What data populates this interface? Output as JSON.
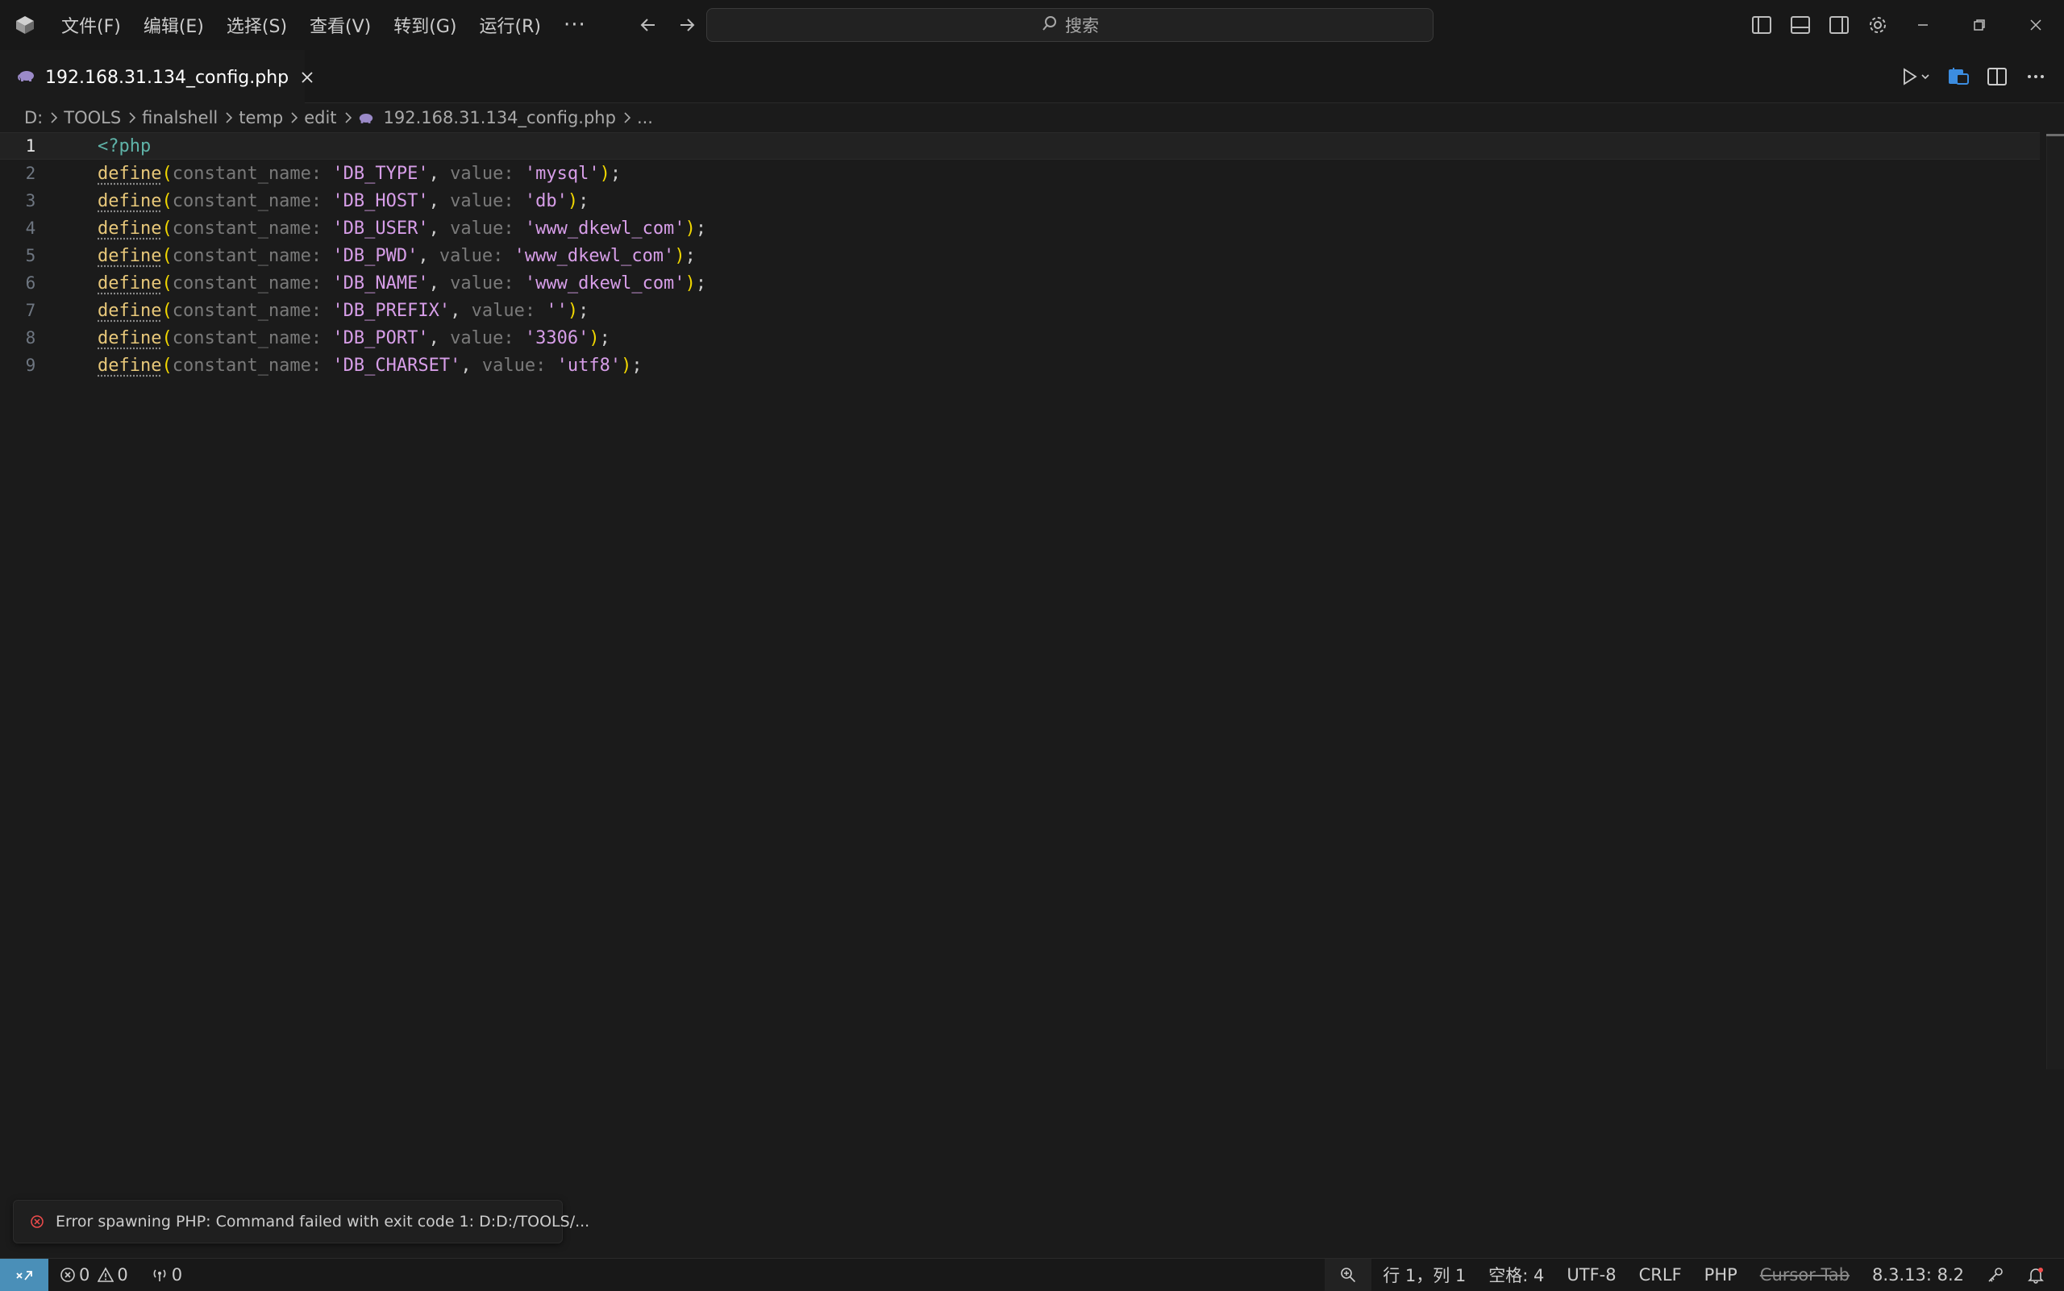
{
  "menu": {
    "items": [
      "文件(F)",
      "编辑(E)",
      "选择(S)",
      "查看(V)",
      "转到(G)",
      "运行(R)"
    ],
    "more": "···"
  },
  "search": {
    "label": "搜索"
  },
  "tab": {
    "label": "192.168.31.134_config.php"
  },
  "breadcrumb": {
    "items": [
      "D:",
      "TOOLS",
      "finalshell",
      "temp",
      "edit"
    ],
    "file": "192.168.31.134_config.php",
    "tail": "..."
  },
  "editor": {
    "line_numbers": [
      "1",
      "2",
      "3",
      "4",
      "5",
      "6",
      "7",
      "8",
      "9"
    ],
    "open_tag": "<?php",
    "fn": "define",
    "hint_name": "constant_name:",
    "hint_value": "value:",
    "lines": [
      {
        "name": "'DB_TYPE'",
        "value": "'mysql'"
      },
      {
        "name": "'DB_HOST'",
        "value": "'db'"
      },
      {
        "name": "'DB_USER'",
        "value": "'www_dkewl_com'"
      },
      {
        "name": "'DB_PWD'",
        "value": "'www_dkewl_com'"
      },
      {
        "name": "'DB_NAME'",
        "value": "'www_dkewl_com'"
      },
      {
        "name": "'DB_PREFIX'",
        "value": "''"
      },
      {
        "name": "'DB_PORT'",
        "value": "'3306'"
      },
      {
        "name": "'DB_CHARSET'",
        "value": "'utf8'"
      }
    ]
  },
  "notification": {
    "text": "Error spawning PHP: Command failed with exit code 1: D:D:/TOOLS/..."
  },
  "status": {
    "errors": "0",
    "warnings": "0",
    "ports": "0",
    "position": "行 1，列 1",
    "spaces": "空格: 4",
    "encoding": "UTF-8",
    "eol": "CRLF",
    "language": "PHP",
    "cursor_tab": "Cursor Tab",
    "version": "8.3.13: 8.2"
  },
  "colors": {
    "accent": "#4a8fb8",
    "string": "#d79ee8",
    "function": "#e8c87a",
    "paren": "#f1d700",
    "error": "#f14c4c"
  }
}
